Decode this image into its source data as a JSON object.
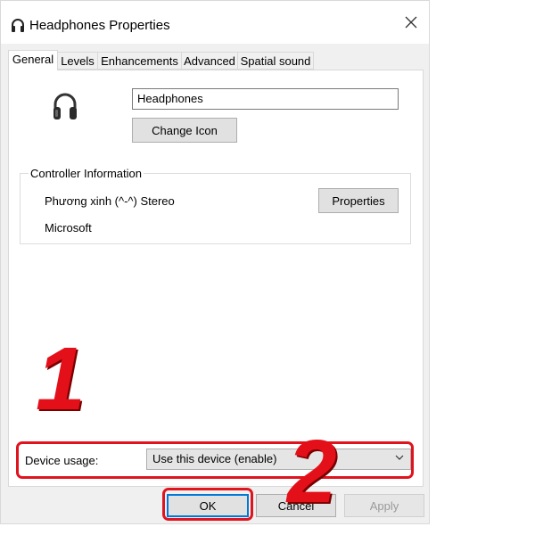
{
  "window": {
    "title": "Headphones Properties"
  },
  "tabs": [
    {
      "label": "General",
      "active": true
    },
    {
      "label": "Levels",
      "active": false
    },
    {
      "label": "Enhancements",
      "active": false
    },
    {
      "label": "Advanced",
      "active": false
    },
    {
      "label": "Spatial sound",
      "active": false
    }
  ],
  "general": {
    "device_name_value": "Headphones",
    "change_icon_label": "Change Icon",
    "controller_group_title": "Controller Information",
    "controller_name": "Phương xinh (^-^) Stereo",
    "properties_label": "Properties",
    "manufacturer": "Microsoft",
    "device_usage_label": "Device usage:",
    "device_usage_selected": "Use this device (enable)"
  },
  "footer": {
    "ok_label": "OK",
    "cancel_label": "Cancel",
    "apply_label": "Apply"
  },
  "annotations": {
    "step1": "1",
    "step2": "2",
    "highlight_color": "#e0141e"
  },
  "icons": {
    "title": "headphones-icon",
    "close": "close-icon",
    "device": "headphones-icon",
    "dropdown": "chevron-down-icon"
  }
}
